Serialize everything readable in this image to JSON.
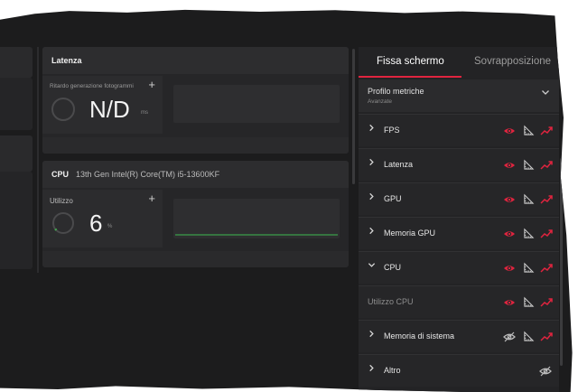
{
  "latency_panel": {
    "title": "Latenza",
    "metric_label": "Ritardo generazione fotogrammi",
    "value": "N/D",
    "unit": "ms"
  },
  "cpu_panel": {
    "title": "CPU",
    "subtitle": "13th Gen Intel(R) Core(TM) i5-13600KF",
    "metric_label": "Utilizzo",
    "value": "6",
    "unit": "%"
  },
  "tabs": {
    "active": "Fissa schermo",
    "inactive": "Sovrapposizione"
  },
  "profile": {
    "title": "Profilo metriche",
    "subtitle": "Avanzate"
  },
  "rows": [
    {
      "label": "FPS",
      "arrow": "›",
      "eye": "on",
      "ruler": true,
      "trend": true
    },
    {
      "label": "Latenza",
      "arrow": "›",
      "eye": "on",
      "ruler": true,
      "trend": true
    },
    {
      "label": "GPU",
      "arrow": "›",
      "eye": "on",
      "ruler": true,
      "trend": true
    },
    {
      "label": "Memoria GPU",
      "arrow": "›",
      "eye": "on",
      "ruler": true,
      "trend": true
    },
    {
      "label": "CPU",
      "arrow": "⌄",
      "eye": "on",
      "ruler": true,
      "trend": true
    },
    {
      "label": "Utilizzo CPU",
      "arrow": "",
      "eye": "on",
      "ruler": true,
      "trend": true
    },
    {
      "label": "Memoria di sistema",
      "arrow": "›",
      "eye": "off",
      "ruler": true,
      "trend": true
    },
    {
      "label": "Altro",
      "arrow": "›",
      "eye": "off",
      "ruler": false,
      "trend": false
    }
  ],
  "colors": {
    "accent": "#e0243f",
    "graph_line": "#3fb950",
    "background": "#1c1c1d"
  },
  "icons": {
    "visible": "eye-icon",
    "hidden": "eye-off-icon",
    "ruler": "ruler-icon",
    "trend": "trend-icon",
    "add": "plus-icon",
    "expand": "chevron-down-icon"
  }
}
